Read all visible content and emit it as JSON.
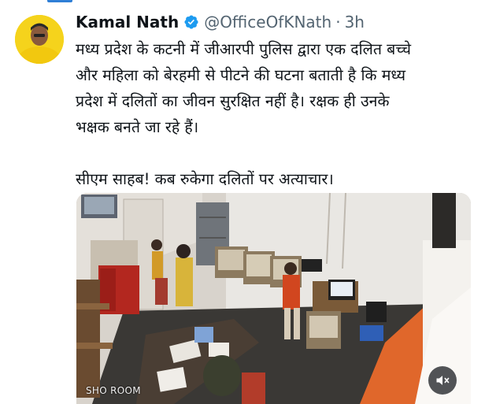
{
  "tweet": {
    "author_name": "Kamal Nath",
    "handle": "@OfficeOfKNath",
    "separator": "·",
    "time": "3h",
    "text_lines": [
      "मध्य प्रदेश के कटनी में जीआरपी पुलिस द्वारा एक दलित बच्चे",
      "और महिला को बेरहमी से पीटने की घटना बताती है कि मध्य",
      "प्रदेश में दलितों का जीवन सुरक्षित नहीं है। रक्षक ही उनके",
      "भक्षक बनते जा रहे हैं।"
    ],
    "text_line_2": "सीएम साहब! कब रुकेगा दलितों पर अत्याचार।"
  },
  "media": {
    "camera_label": "SHO ROOM",
    "mute_icon": "speaker-muted-icon"
  },
  "colors": {
    "verified": "#1d9bf0",
    "handle_gray": "#536471",
    "text": "#0f1419",
    "accent_strip": "#2f7fd6"
  }
}
